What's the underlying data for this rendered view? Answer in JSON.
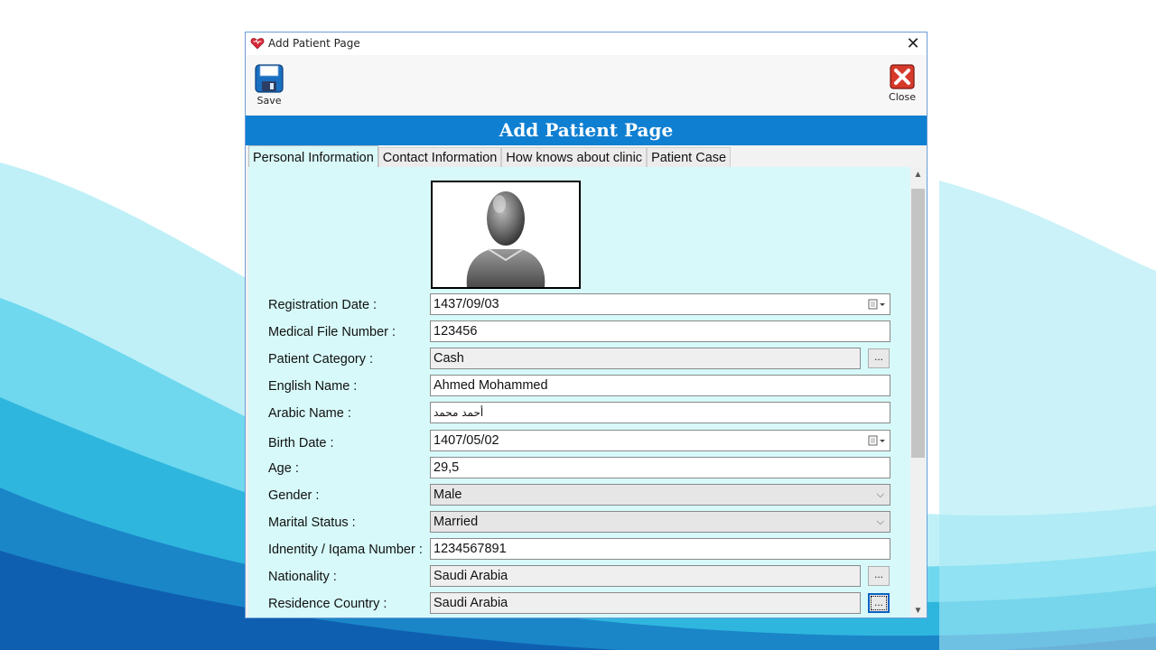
{
  "window": {
    "title": "Add Patient Page",
    "close_symbol": "✕"
  },
  "toolbar": {
    "save_label": "Save",
    "close_label": "Close"
  },
  "header": {
    "title": "Add Patient Page"
  },
  "tabs": [
    {
      "label": "Personal Information",
      "active": true
    },
    {
      "label": "Contact Information",
      "active": false
    },
    {
      "label": "How knows about clinic",
      "active": false
    },
    {
      "label": "Patient Case",
      "active": false
    }
  ],
  "form": {
    "registration_date": {
      "label": "Registration Date :",
      "value": "1437/09/03"
    },
    "medical_file_number": {
      "label": "Medical File Number :",
      "value": "123456"
    },
    "patient_category": {
      "label": "Patient Category :",
      "value": "Cash"
    },
    "english_name": {
      "label": "English Name :",
      "value": "Ahmed Mohammed"
    },
    "arabic_name": {
      "label": "Arabic Name :",
      "value": "أحمد محمد"
    },
    "birth_date": {
      "label": "Birth Date :",
      "value": "1407/05/02"
    },
    "age": {
      "label": "Age :",
      "value": "29,5"
    },
    "gender": {
      "label": "Gender :",
      "value": "Male"
    },
    "marital_status": {
      "label": "Marital Status :",
      "value": "Married"
    },
    "identity_number": {
      "label": "Idnentity / Iqama Number :",
      "value": "1234567891"
    },
    "nationality": {
      "label": "Nationality :",
      "value": "Saudi Arabia"
    },
    "residence_country": {
      "label": "Residence Country :",
      "value": "Saudi Arabia"
    },
    "ellipsis_label": "...",
    "dropdown_symbol": "⌵",
    "scroll_up_symbol": "▲",
    "scroll_down_symbol": "▼"
  },
  "colors": {
    "header_blue": "#0f7fd1",
    "panel_cyan": "#d7f9f9",
    "close_red": "#d63a2a",
    "save_blue": "#1a6fc0"
  },
  "icons": {
    "app": "heart-icon",
    "save": "floppy-disk-icon",
    "close": "red-x-icon",
    "avatar": "user-silhouette-icon",
    "calendar": "calendar-dropdown-icon"
  }
}
